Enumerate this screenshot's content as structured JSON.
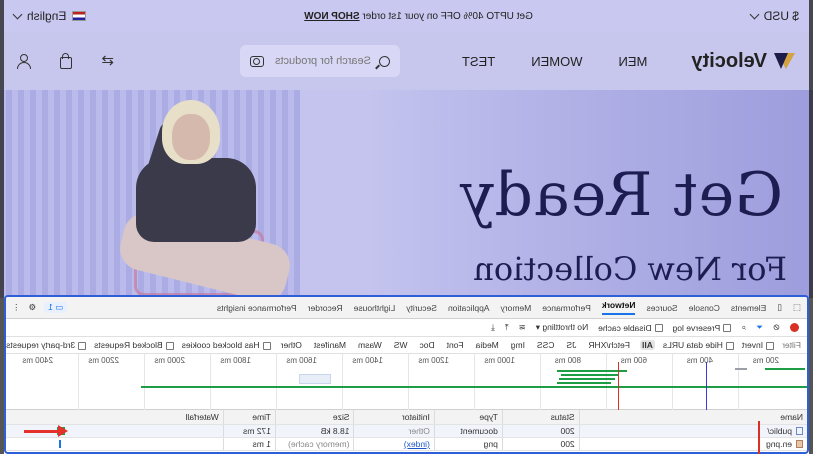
{
  "announcement": {
    "currency": "$ USD",
    "language": "English",
    "promo_text": "Get UPTO 40% OFF on your 1st order",
    "promo_link": "SHOP NOW"
  },
  "header": {
    "brand": "Velocity",
    "nav": [
      "MEN",
      "WOMEN",
      "TEST"
    ],
    "search_placeholder": "Search for products"
  },
  "hero": {
    "headline": "Get Ready",
    "subline": "For New Collection"
  },
  "devtools": {
    "tabs": [
      "Elements",
      "Console",
      "Sources",
      "Network",
      "Performance",
      "Memory",
      "Application",
      "Security",
      "Lighthouse",
      "Recorder",
      "Performance insights"
    ],
    "active_tab": "Network",
    "message_count": "1",
    "toolbar": {
      "preserve_log": "Preserve log",
      "disable_cache": "Disable cache",
      "throttling": "No throttling"
    },
    "filter": {
      "label": "Filter",
      "invert": "Invert",
      "hide_data_urls": "Hide data URLs",
      "types": [
        "All",
        "Fetch/XHR",
        "JS",
        "CSS",
        "Img",
        "Media",
        "Font",
        "Doc",
        "WS",
        "Wasm",
        "Manifest",
        "Other"
      ],
      "active_type": "All",
      "blocked_cookies": "Has blocked cookies",
      "blocked_requests": "Blocked Requests",
      "third_party": "3rd-party requests"
    },
    "timeline_ticks": [
      "200 ms",
      "400 ms",
      "600 ms",
      "800 ms",
      "1000 ms",
      "1200 ms",
      "1400 ms",
      "1600 ms",
      "1800 ms",
      "2000 ms",
      "2200 ms",
      "2400 ms"
    ],
    "columns": [
      "Name",
      "Status",
      "Type",
      "Initiator",
      "Size",
      "Time",
      "Waterfall"
    ],
    "rows": [
      {
        "name": "public/",
        "status": "200",
        "type": "document",
        "initiator": "Other",
        "size": "18.8 kB",
        "time": "172 ms"
      },
      {
        "name": "en.png",
        "status": "200",
        "type": "png",
        "initiator": "(index)",
        "size": "(memory cache)",
        "time": "1 ms"
      }
    ],
    "colors": {
      "accent": "#1a73e8",
      "bar": "#1e9e44",
      "highlight": "#2f5fd8",
      "arrow": "#e5312b"
    }
  }
}
